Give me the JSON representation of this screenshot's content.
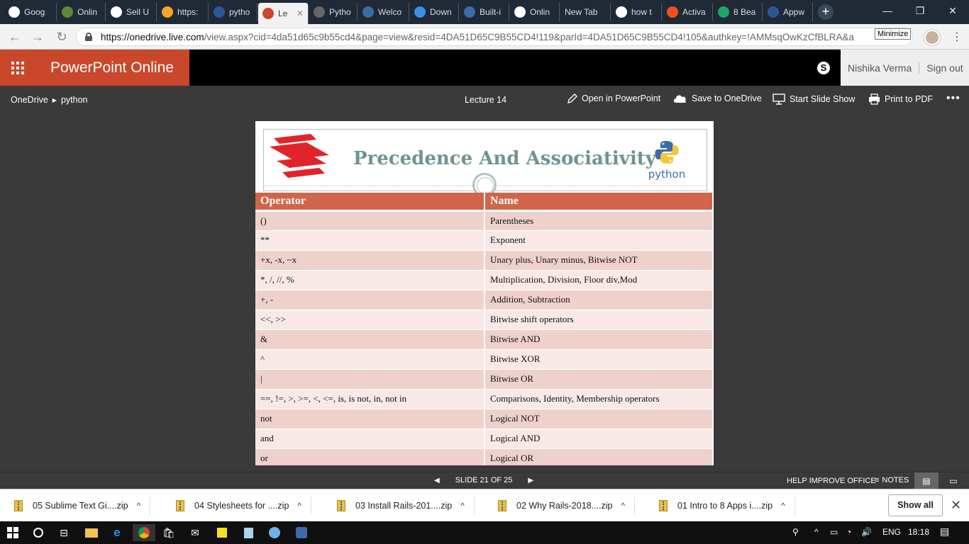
{
  "browser": {
    "tabs": [
      {
        "title": "Goog",
        "icon": "google-icon",
        "color": "#ffffff"
      },
      {
        "title": "Onlin",
        "icon": "leaf-icon",
        "color": "#5a8a3a"
      },
      {
        "title": "Sell U",
        "icon": "amazon-icon",
        "color": "#ffffff"
      },
      {
        "title": "https:",
        "icon": "doc-icon",
        "color": "#f6a623"
      },
      {
        "title": "pytho",
        "icon": "onedrive-icon",
        "color": "#2b5797"
      },
      {
        "title": "Le",
        "icon": "powerpoint-icon",
        "color": "#c9472b"
      },
      {
        "title": "Pytho",
        "icon": "page-icon",
        "color": "#666666"
      },
      {
        "title": "Welco",
        "icon": "python-icon",
        "color": "#3c6ca8"
      },
      {
        "title": "Down",
        "icon": "download-icon",
        "color": "#3a8ee6"
      },
      {
        "title": "Built-i",
        "icon": "python-icon",
        "color": "#3c6ca8"
      },
      {
        "title": "Onlin",
        "icon": "amazon-icon",
        "color": "#ffffff"
      },
      {
        "title": "New Tab",
        "icon": "",
        "color": ""
      },
      {
        "title": "how t",
        "icon": "google-icon",
        "color": "#ffffff"
      },
      {
        "title": "Activa",
        "icon": "windows-icon",
        "color": "#f25022"
      },
      {
        "title": "8 Bea",
        "icon": "drive-icon",
        "color": "#1fa463"
      },
      {
        "title": "Appw",
        "icon": "site-icon",
        "color": "#2b5797"
      }
    ],
    "new_tab": "+",
    "window_controls": {
      "minimize": "—",
      "maximize": "❐",
      "close": "✕"
    },
    "url_host": "https://onedrive.live.com",
    "url_rest": "/view.aspx?cid=4da51d65c9b55cd4&page=view&resid=4DA51D65C9B55CD4!119&parId=4DA51D65C9B55CD4!105&authkey=!AMMsqOwKzCfBLRA&a",
    "tooltip": "Minimize"
  },
  "office": {
    "app_name": "PowerPoint Online",
    "user_name": "Nishika Verma",
    "sign_out": "Sign out"
  },
  "commandbar": {
    "crumb_root": "OneDrive",
    "crumb_folder": "python",
    "doc_title": "Lecture 14",
    "open_in_app": "Open in PowerPoint",
    "save": "Save to OneDrive",
    "slideshow": "Start Slide Show",
    "print": "Print to PDF",
    "more": "•••"
  },
  "slide": {
    "title": "Precedence And Associativity",
    "python_word": "python",
    "headers": [
      "Operator",
      "Name"
    ],
    "rows": [
      [
        "()",
        "Parentheses"
      ],
      [
        "**",
        "Exponent"
      ],
      [
        "+x, -x, ~x",
        "Unary plus, Unary minus, Bitwise NOT"
      ],
      [
        "*, /, //, %",
        "Multiplication, Division, Floor div,Mod"
      ],
      [
        "+, -",
        "Addition, Subtraction"
      ],
      [
        "<<, >>",
        "Bitwise shift operators"
      ],
      [
        "&",
        "Bitwise AND"
      ],
      [
        "^",
        "Bitwise XOR"
      ],
      [
        "|",
        "Bitwise OR"
      ],
      [
        "==, !=, >, >=, <, <=, is, is not, in, not in",
        "Comparisons, Identity, Membership operators"
      ],
      [
        "not",
        "Logical NOT"
      ],
      [
        "and",
        "Logical AND"
      ],
      [
        "or",
        "Logical OR"
      ]
    ],
    "colors": {
      "header": "#d0654a",
      "row_odd": "#efd1cc",
      "row_even": "#f8e9e7",
      "title": "#6e9392",
      "logo_red": "#e0242a"
    }
  },
  "status": {
    "slide_counter": "SLIDE 21 OF 25",
    "help": "HELP IMPROVE OFFICE",
    "notes": "NOTES"
  },
  "downloads": {
    "items": [
      "05 Sublime Text Gi....zip",
      "04 Stylesheets for ....zip",
      "03 Install Rails-201....zip",
      "02 Why Rails-2018....zip",
      "01 Intro to 8 Apps i....zip"
    ],
    "show_all": "Show all"
  },
  "taskbar": {
    "language": "ENG",
    "time": "18:18"
  }
}
